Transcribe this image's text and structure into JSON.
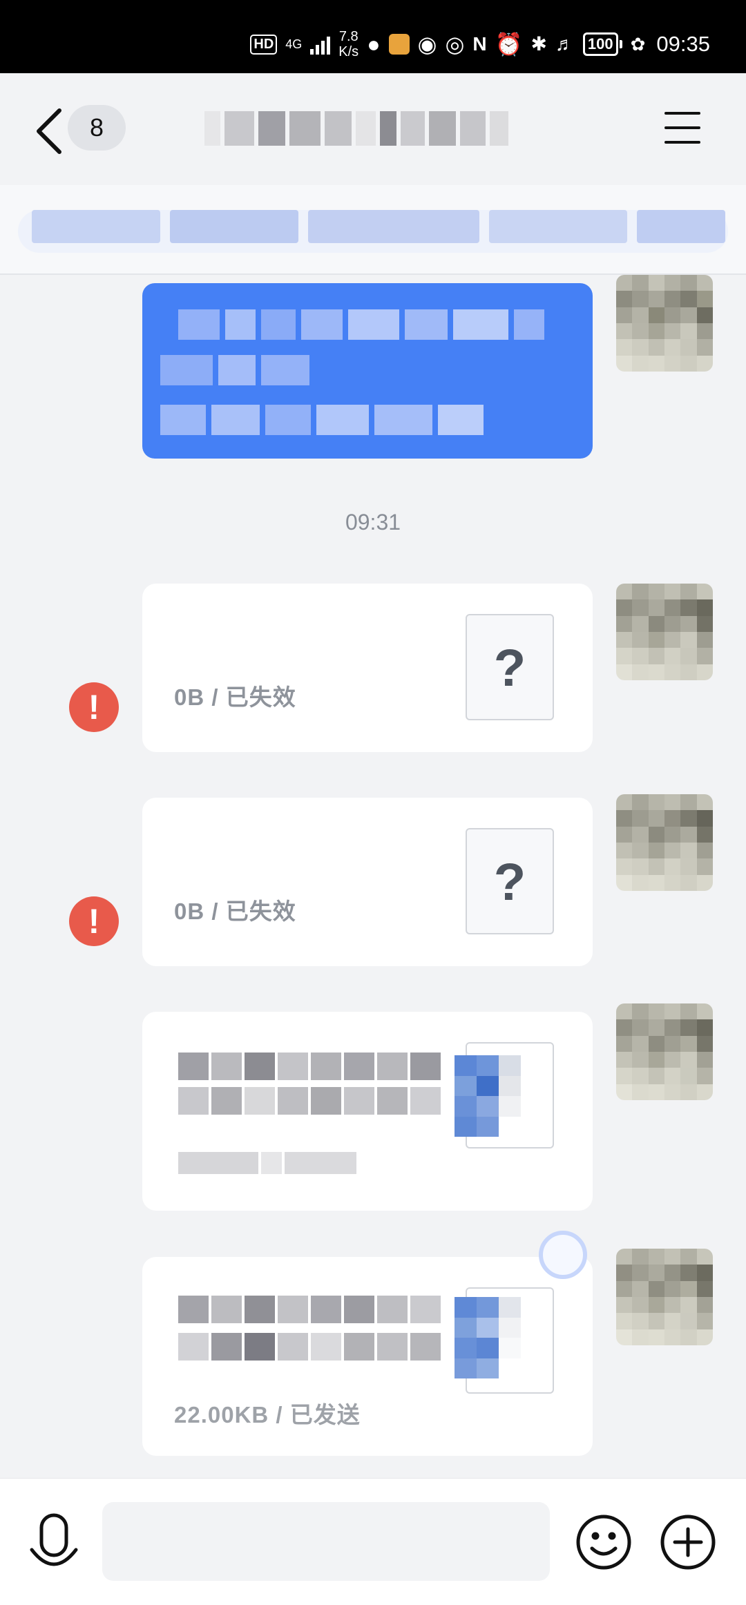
{
  "status_bar": {
    "hd": "HD",
    "network_type": "4G",
    "speed_value": "7.8",
    "speed_unit": "K/s",
    "battery": "100",
    "time": "09:35"
  },
  "header": {
    "unread_count": "8"
  },
  "messages": {
    "timestamp": "09:31",
    "failed_file_1": {
      "meta": "0B  /  已失效",
      "icon": "?"
    },
    "failed_file_2": {
      "meta": "0B  /  已失效",
      "icon": "?"
    },
    "doc_file_2": {
      "meta": "22.00KB / 已发送"
    }
  },
  "icons": {
    "back": "chevron-left-icon",
    "menu": "hamburger-menu-icon",
    "error": "exclamation-circle-icon",
    "voice": "microphone-icon",
    "emoji": "smiley-icon",
    "plus": "plus-circle-icon"
  },
  "colors": {
    "accent_blue": "#4580F5",
    "error_red": "#E85A4B",
    "background": "#F2F3F5"
  }
}
